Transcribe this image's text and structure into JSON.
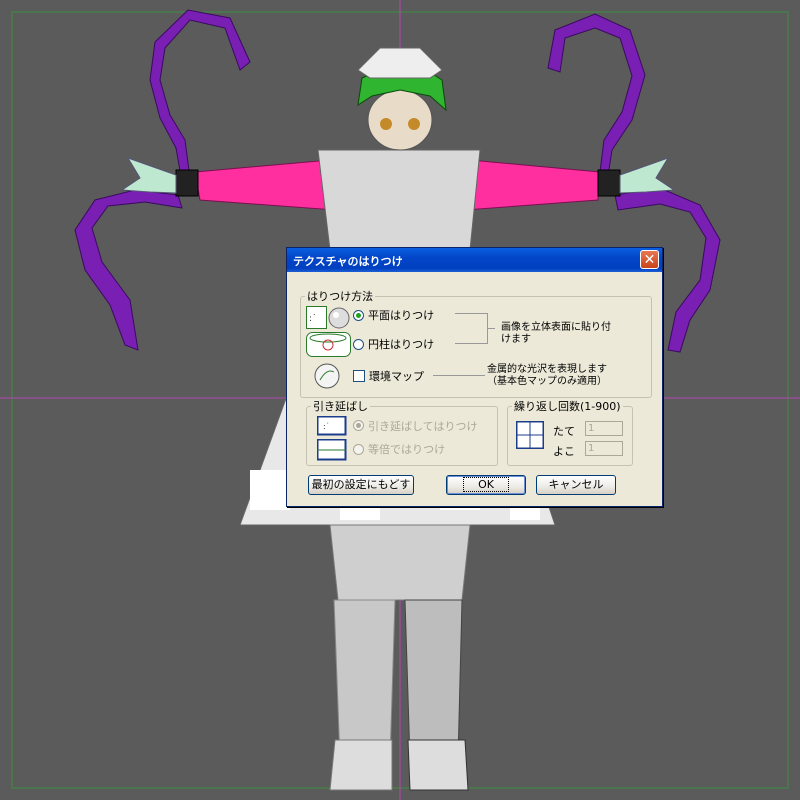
{
  "dialog": {
    "title": "テクスチャのはりつけ",
    "close_glyph": "✕",
    "mapping_group": {
      "legend": "はりつけ方法",
      "planar_label": "平面はりつけ",
      "cylindrical_label": "円柱はりつけ",
      "selected": "planar",
      "projection_note_line1": "画像を立体表面に貼り付",
      "projection_note_line2": "けます",
      "envmap_label": "環境マップ",
      "envmap_checked": false,
      "envmap_note_line1": "金属的な光沢を表現します",
      "envmap_note_line2": "（基本色マップのみ適用）"
    },
    "stretch_group": {
      "legend": "引き延ばし",
      "stretch_label": "引き延ばしてはりつけ",
      "same_scale_label": "等倍ではりつけ",
      "selected": "stretch"
    },
    "repeat_group": {
      "legend": "繰り返し回数(1-900)",
      "vertical_label": "たて",
      "vertical_value": "1",
      "horizontal_label": "よこ",
      "horizontal_value": "1"
    },
    "reset_button": "最初の設定にもどす",
    "ok_button": "OK",
    "cancel_button": "キャンセル"
  },
  "colors": {
    "viewport_bg": "#5b5b5b",
    "tentacle": "#7a1fb3",
    "sleeve": "#ff2fa0",
    "hair": "#2fb52f",
    "axis_vertical": "#b04ab0",
    "axis_horizontal": "#b04ab0",
    "border_green": "#49a049"
  }
}
